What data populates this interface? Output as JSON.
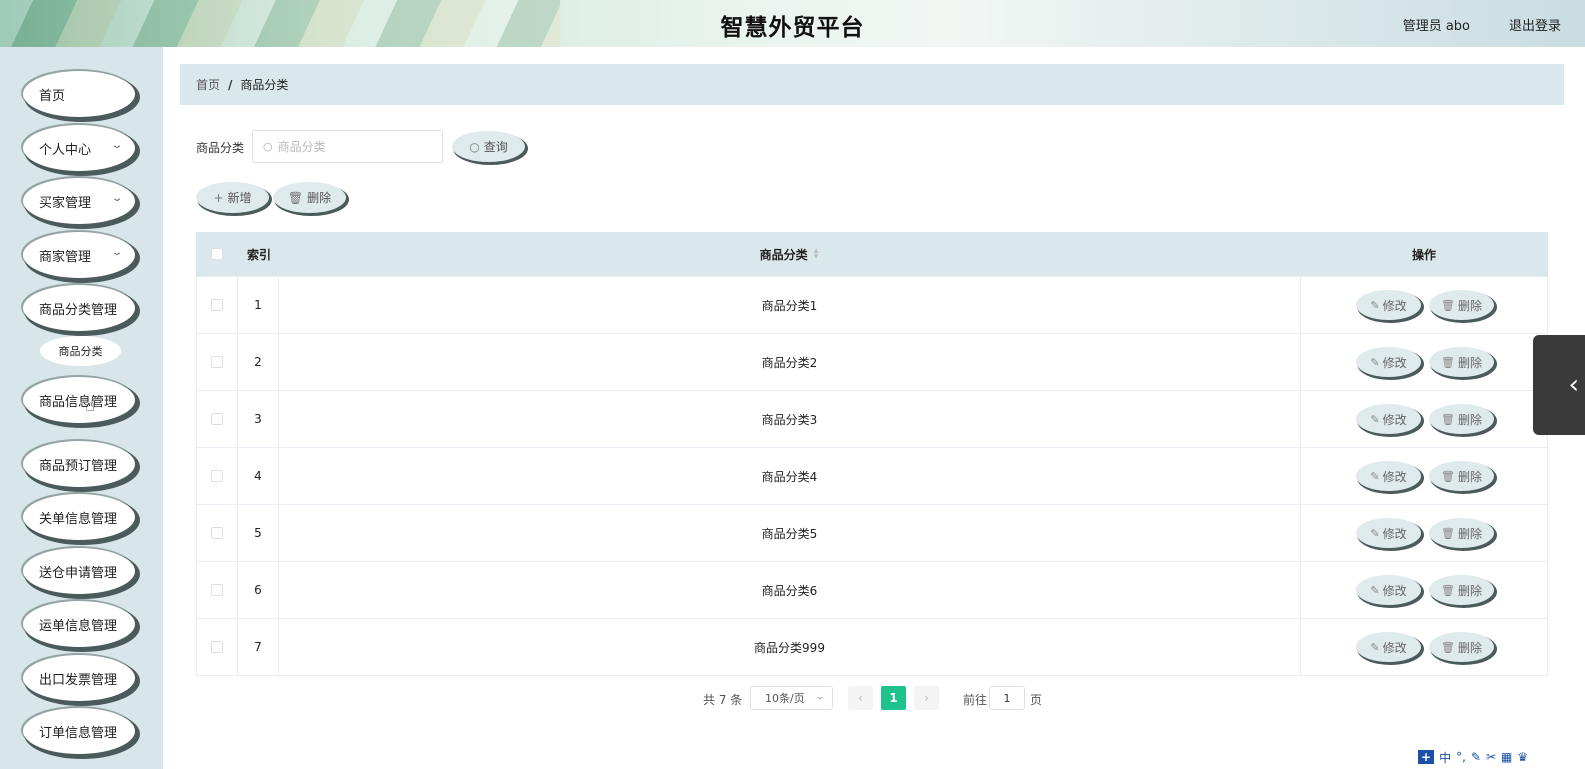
{
  "header": {
    "title": "智慧外贸平台",
    "user": "管理员 abo",
    "logout": "退出登录"
  },
  "sidebar": {
    "items": [
      {
        "label": "首页",
        "has_arrow": false
      },
      {
        "label": "个人中心",
        "has_arrow": true
      },
      {
        "label": "买家管理",
        "has_arrow": true
      },
      {
        "label": "商家管理",
        "has_arrow": true
      },
      {
        "label": "商品分类管理",
        "has_arrow": false
      },
      {
        "label": "商品信息管理",
        "has_arrow": false
      },
      {
        "label": "商品预订管理",
        "has_arrow": false
      },
      {
        "label": "关单信息管理",
        "has_arrow": false
      },
      {
        "label": "送仓申请管理",
        "has_arrow": false
      },
      {
        "label": "运单信息管理",
        "has_arrow": false
      },
      {
        "label": "出口发票管理",
        "has_arrow": false
      },
      {
        "label": "订单信息管理",
        "has_arrow": false
      }
    ],
    "sub_item": "商品分类",
    "arrow_glyph": "⌄"
  },
  "breadcrumb": {
    "home": "首页",
    "separator": "/",
    "current": "商品分类"
  },
  "search": {
    "label": "商品分类",
    "placeholder": "商品分类",
    "query_button": "查询"
  },
  "actions": {
    "add": "新增",
    "delete": "删除"
  },
  "table": {
    "headers": {
      "index": "索引",
      "name": "商品分类",
      "ops": "操作"
    },
    "rows": [
      {
        "index": "1",
        "name": "商品分类1"
      },
      {
        "index": "2",
        "name": "商品分类2"
      },
      {
        "index": "3",
        "name": "商品分类3"
      },
      {
        "index": "4",
        "name": "商品分类4"
      },
      {
        "index": "5",
        "name": "商品分类5"
      },
      {
        "index": "6",
        "name": "商品分类6"
      },
      {
        "index": "7",
        "name": "商品分类999"
      }
    ],
    "edit_label": "修改",
    "delete_label": "删除"
  },
  "pagination": {
    "total": "共 7 条",
    "page_size": "10条/页",
    "current_page": "1",
    "goto_label": "前往",
    "goto_value": "1",
    "page_unit": "页"
  },
  "colors": {
    "accent": "#1ec28b",
    "sidebar_bg": "#d9e6e9",
    "header_row_bg": "#dbe8eb"
  }
}
